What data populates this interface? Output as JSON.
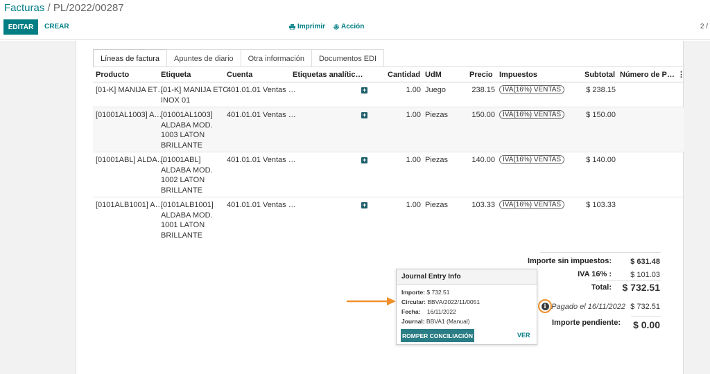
{
  "breadcrumb": {
    "root": "Facturas",
    "separator": " / ",
    "current": "PL/2022/00287"
  },
  "toolbar": {
    "edit": "EDITAR",
    "create": "CREAR",
    "print": "Imprimir",
    "action": "Acción",
    "pager": "2 /"
  },
  "tabs": [
    "Líneas de factura",
    "Apuntes de diario",
    "Otra información",
    "Documentos EDI"
  ],
  "columns": [
    "Producto",
    "Etiqueta",
    "Cuenta",
    "Etiquetas analític…",
    "Cantidad",
    "UdM",
    "Precio",
    "Impuestos",
    "Subtotal",
    "Número de P…"
  ],
  "lines": [
    {
      "product": "[01-K] MANIJA ET…",
      "label": [
        "[01-K] MANIJA ETC",
        "INOX 01"
      ],
      "account": "401.01.01 Ventas …",
      "qty": "1.00",
      "uom": "Juego",
      "price": "238.15",
      "tax": "IVA(16%) VENTAS",
      "subtotal": "$ 238.15"
    },
    {
      "product": "[01001AL1003] A…",
      "label": [
        "[01001AL1003]",
        "ALDABA MOD.",
        "1003 LATON",
        "BRILLANTE"
      ],
      "account": "401.01.01 Ventas …",
      "qty": "1.00",
      "uom": "Piezas",
      "price": "150.00",
      "tax": "IVA(16%) VENTAS",
      "subtotal": "$ 150.00"
    },
    {
      "product": "[01001ABL] ALDA…",
      "label": [
        "[01001ABL]",
        "ALDABA MOD.",
        "1002 LATON",
        "BRILLANTE"
      ],
      "account": "401.01.01 Ventas …",
      "qty": "1.00",
      "uom": "Piezas",
      "price": "140.00",
      "tax": "IVA(16%) VENTAS",
      "subtotal": "$ 140.00"
    },
    {
      "product": "[0101ALB1001] A…",
      "label": [
        "[0101ALB1001]",
        "ALDABA MOD.",
        "1001 LATON",
        "BRILLANTE"
      ],
      "account": "401.01.01 Ventas …",
      "qty": "1.00",
      "uom": "Piezas",
      "price": "103.33",
      "tax": "IVA(16%) VENTAS",
      "subtotal": "$ 103.33"
    }
  ],
  "totals": {
    "untaxed_label": "Importe sin impuestos:",
    "untaxed": "$ 631.48",
    "iva_label": "IVA 16% :",
    "iva": "$ 101.03",
    "total_label": "Total:",
    "total": "$ 732.51",
    "paid_label": "Pagado el 16/11/2022",
    "paid": "$ 732.51",
    "due_label": "Importe pendiente:",
    "due": "$ 0.00"
  },
  "popover": {
    "title": "Journal Entry Info",
    "amount_label": "Importe:",
    "amount": "$ 732.51",
    "circular_label": "Circular:",
    "circular": "BBVA/2022/11/0051",
    "date_label": "Fecha:",
    "date": "16/11/2022",
    "journal_label": "Journal:",
    "journal": "BBVA1 (Manual)",
    "unreconcile": "ROMPER CONCILIACIÓN",
    "view": "VER"
  },
  "colors": {
    "accent": "#017e84",
    "highlight": "#f0902b"
  }
}
